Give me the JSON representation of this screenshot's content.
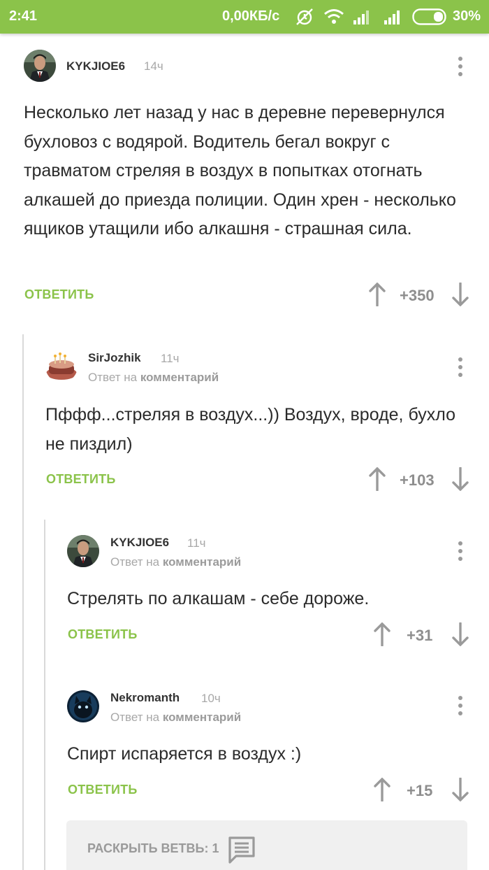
{
  "status_bar": {
    "time": "2:41",
    "network_speed": "0,00КБ/с",
    "battery": "30%",
    "icons": [
      "alarm-off-icon",
      "wifi-icon",
      "signal-icon",
      "signal-icon",
      "battery-icon"
    ]
  },
  "accent_color": "#8bc34a",
  "comments": [
    {
      "author": "KYKJIOE6",
      "time": "14ч",
      "text": "Несколько лет назад у нас в деревне перевернулся бухловоз с водярой. Водитель бегал вокруг с травматом стреляя в воздух в попытках отогнать алкашей до приезда полиции. Один хрен - несколько ящиков утащили ибо алкашня - страшная сила.",
      "reply_label": "ОТВЕТИТЬ",
      "score": "+350"
    },
    {
      "author": "SirJozhik",
      "time": "11ч",
      "reply_to_prefix": "Ответ на",
      "reply_to_link": "комментарий",
      "text": "Пффф...стреляя в воздух...)) Воздух, вроде, бухло не пиздил)",
      "reply_label": "ОТВЕТИТЬ",
      "score": "+103"
    },
    {
      "author": "KYKJIOE6",
      "time": "11ч",
      "reply_to_prefix": "Ответ на",
      "reply_to_link": "комментарий",
      "text": "Стрелять по алкашам - себе дороже.",
      "reply_label": "ОТВЕТИТЬ",
      "score": "+31"
    },
    {
      "author": "Nekromanth",
      "time": "10ч",
      "reply_to_prefix": "Ответ на",
      "reply_to_link": "комментарий",
      "text": "Спирт испаряется в воздух :)",
      "reply_label": "ОТВЕТИТЬ",
      "score": "+15"
    }
  ],
  "expand_branch": {
    "label": "РАСКРЫТЬ ВЕТВЬ: 1"
  }
}
